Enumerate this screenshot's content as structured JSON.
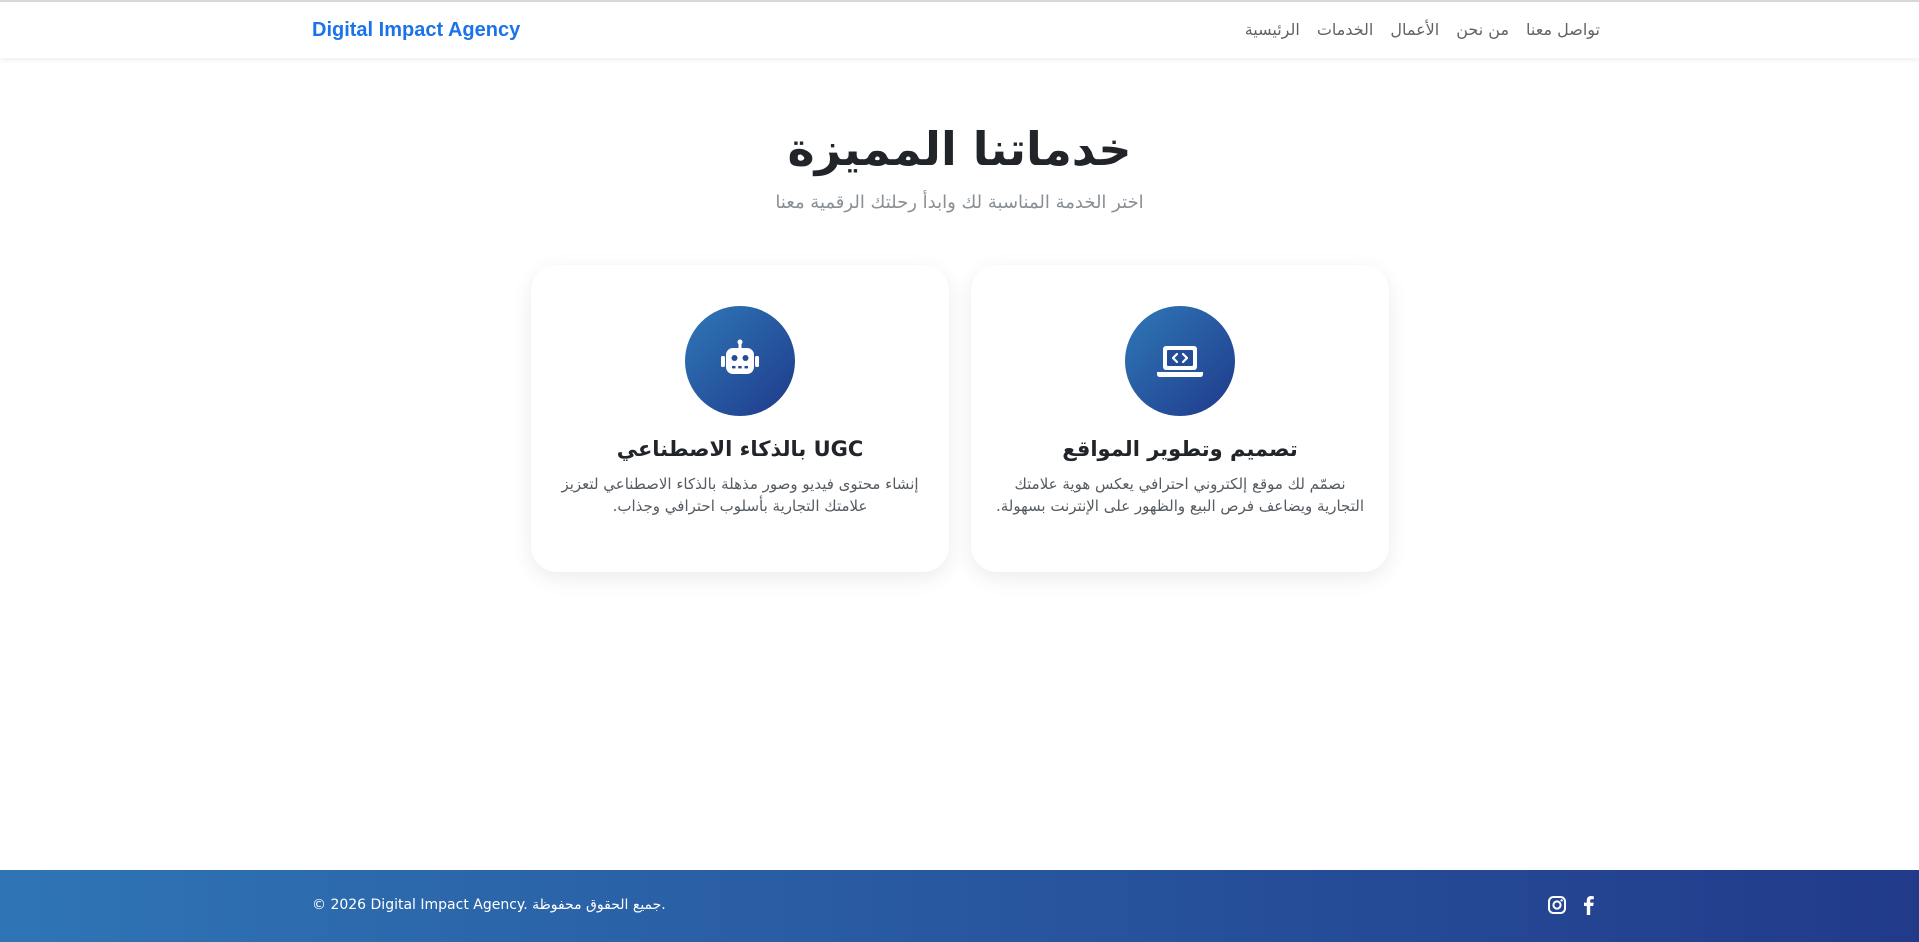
{
  "navbar": {
    "brand": "Digital Impact Agency",
    "links": [
      {
        "label": "الرئيسية"
      },
      {
        "label": "الخدمات"
      },
      {
        "label": "الأعمال"
      },
      {
        "label": "من نحن"
      },
      {
        "label": "تواصل معنا"
      }
    ]
  },
  "hero": {
    "title": "خدماتنا المميزة",
    "subtitle": "اختر الخدمة المناسبة لك وابدأ رحلتك الرقمية معنا"
  },
  "services": [
    {
      "icon": "robot-icon",
      "title": "UGC بالذكاء الاصطناعي",
      "description": "إنشاء محتوى فيديو وصور مذهلة بالذكاء الاصطناعي لتعزيز علامتك التجارية بأسلوب احترافي وجذاب."
    },
    {
      "icon": "laptop-code-icon",
      "title": "تصميم وتطوير المواقع",
      "description": "نصمّم لك موقع إلكتروني احترافي يعكس هوية علامتك التجارية ويضاعف فرص البيع والظهور على الإنترنت بسهولة."
    }
  ],
  "footer": {
    "copyright": "© 2026 Digital Impact Agency. جميع الحقوق محفوظة.",
    "socials": [
      "instagram-icon",
      "facebook-icon"
    ]
  },
  "colors": {
    "brand": "#1a73e8",
    "gradient_start": "#2f78b8",
    "gradient_end": "#1f3a8a"
  }
}
